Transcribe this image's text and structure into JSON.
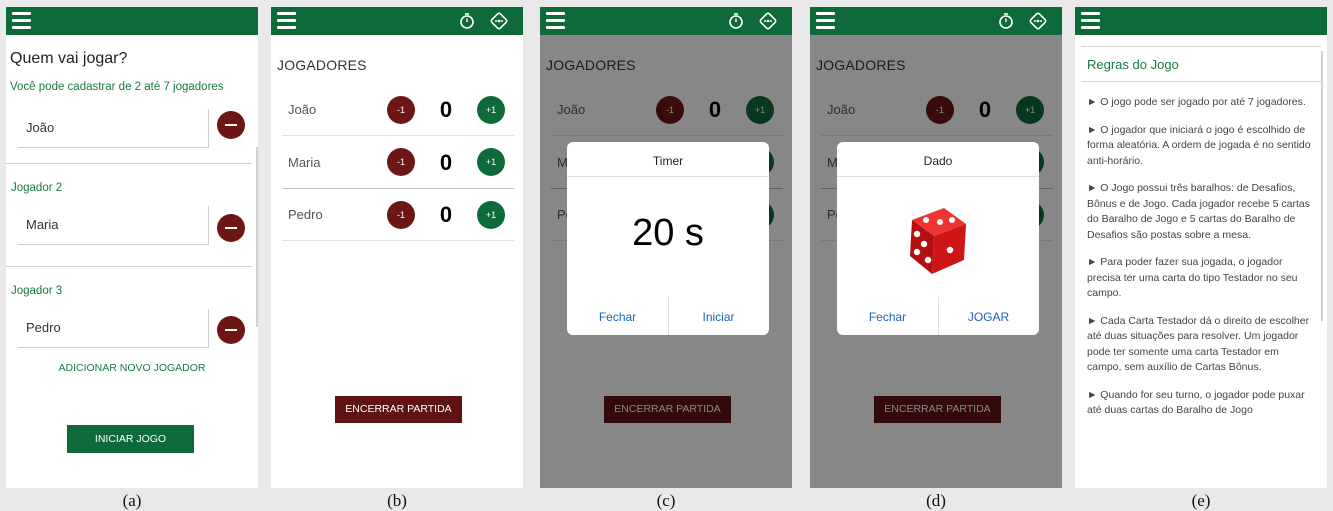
{
  "panel_a": {
    "title": "Quem vai jogar?",
    "subtitle": "Você pode cadastrar de 2 até 7 jogadores",
    "players": [
      {
        "label": "",
        "name": "João"
      },
      {
        "label": "Jogador 2",
        "name": "Maria"
      },
      {
        "label": "Jogador 3",
        "name": "Pedro"
      }
    ],
    "add_player": "ADICIONAR NOVO JOGADOR",
    "start_game": "INICIAR JOGO"
  },
  "players_panel": {
    "title": "JOGADORES",
    "minus_label": "-1",
    "plus_label": "+1",
    "players": [
      {
        "name": "João",
        "score": "0"
      },
      {
        "name": "Maria",
        "score": "0"
      },
      {
        "name": "Pedro",
        "score": "0"
      }
    ],
    "end_match": "ENCERRAR PARTIDA"
  },
  "timer_dialog": {
    "title": "Timer",
    "value": "20 s",
    "close": "Fechar",
    "start": "Iniciar"
  },
  "dice_dialog": {
    "title": "Dado",
    "close": "Fechar",
    "play": "JOGAR"
  },
  "rules_panel": {
    "title": "Regras do Jogo",
    "rules": [
      "► O jogo pode ser jogado por até 7 jogadores.",
      "► O jogador que iniciará o jogo é escolhido de forma aleatória. A ordem de jogada é no sentido anti-horário.",
      "► O Jogo possui três baralhos: de Desafios, Bônus e de Jogo. Cada jogador recebe 5 cartas do Baralho de Jogo e 5 cartas do Baralho de Desafios são postas sobre a mesa.",
      "► Para poder fazer sua jogada, o jogador precisa ter uma carta do tipo Testador no seu campo.",
      "► Cada Carta Testador dá o direito de escolher até duas situações para resolver. Um jogador pode ter somente uma carta Testador em campo, sem auxílio de Cartas Bônus.",
      "► Quando for seu turno, o jogador pode puxar até duas cartas do Baralho de Jogo"
    ]
  },
  "captions": [
    "(a)",
    "(b)",
    "(c)",
    "(d)",
    "(e)"
  ],
  "icons": {
    "menu": "menu-icon",
    "timer": "stopwatch-icon",
    "dice": "dice-icon"
  },
  "colors": {
    "primary": "#0e6b39",
    "danger": "#6d1616",
    "link": "#1e5fc2"
  }
}
